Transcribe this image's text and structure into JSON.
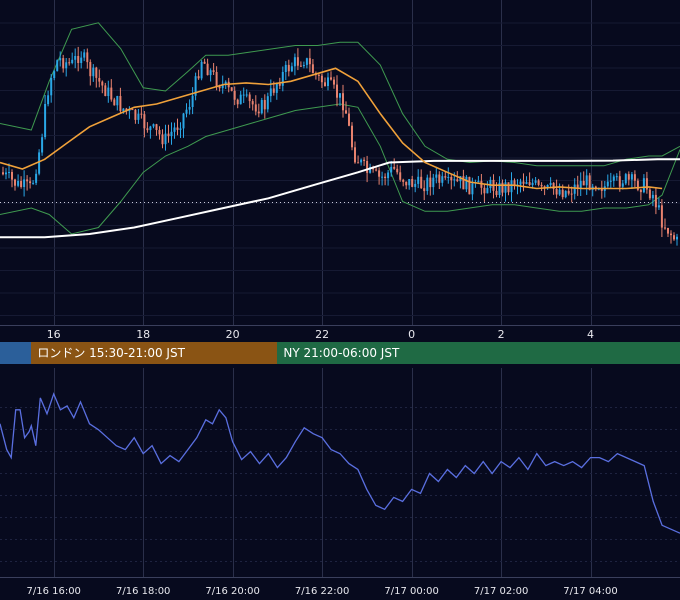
{
  "colors": {
    "background": "#070a1e",
    "grid": "#2a2f4a",
    "candle_up": "#2aa7e6",
    "candle_down": "#e8826e",
    "ma_short": "#f0a13a",
    "ma_long": "#ffffff",
    "bollinger": "#3f9a50",
    "oscillator": "#5a6fe0",
    "session_tokyo": "#2b5f9a",
    "session_london": "#8a5414",
    "session_ny": "#1f6a44"
  },
  "sessions": [
    {
      "label": "",
      "color": "#2b5f9a",
      "start_hour": 14.8,
      "end_hour": 15.5
    },
    {
      "label": "ロンドン 15:30-21:00 JST",
      "color": "#8a5414",
      "start_hour": 15.5,
      "end_hour": 21.0
    },
    {
      "label": "NY 21:00-06:00 JST",
      "color": "#1f6a44",
      "start_hour": 21.0,
      "end_hour": 30.0
    }
  ],
  "chart_data": [
    {
      "type": "candlestick",
      "title": "",
      "x_unit": "hours (JST), 7/16 14:48 – 7/17 05:20",
      "xlim": [
        14.8,
        30.0
      ],
      "ylim": [
        0,
        100
      ],
      "x_tick_labels": [
        "16",
        "18",
        "20",
        "22",
        "0",
        "2",
        "4"
      ],
      "x_tick_hours": [
        16,
        18,
        20,
        22,
        24,
        26,
        28
      ],
      "gridlines": true,
      "reference_line": 62,
      "close_path": [
        [
          14.8,
          53
        ],
        [
          15.2,
          57
        ],
        [
          15.5,
          58
        ],
        [
          15.7,
          45
        ],
        [
          15.9,
          25
        ],
        [
          16.1,
          18
        ],
        [
          16.4,
          20
        ],
        [
          16.6,
          16
        ],
        [
          16.8,
          22
        ],
        [
          17.0,
          25
        ],
        [
          17.3,
          30
        ],
        [
          17.6,
          34
        ],
        [
          17.9,
          37
        ],
        [
          18.2,
          40
        ],
        [
          18.5,
          43
        ],
        [
          18.8,
          38
        ],
        [
          19.1,
          30
        ],
        [
          19.3,
          18
        ],
        [
          19.6,
          24
        ],
        [
          19.9,
          28
        ],
        [
          20.1,
          30
        ],
        [
          20.4,
          32
        ],
        [
          20.7,
          33
        ],
        [
          21.0,
          25
        ],
        [
          21.3,
          20
        ],
        [
          21.6,
          18
        ],
        [
          21.9,
          24
        ],
        [
          22.2,
          27
        ],
        [
          22.5,
          32
        ],
        [
          22.7,
          47
        ],
        [
          23.0,
          53
        ],
        [
          23.3,
          55
        ],
        [
          23.6,
          52
        ],
        [
          23.9,
          56
        ],
        [
          24.2,
          57
        ],
        [
          24.5,
          55
        ],
        [
          24.8,
          57
        ],
        [
          25.1,
          56
        ],
        [
          25.4,
          58
        ],
        [
          25.7,
          57
        ],
        [
          26.0,
          58
        ],
        [
          26.3,
          56
        ],
        [
          26.6,
          55
        ],
        [
          26.9,
          59
        ],
        [
          27.2,
          58
        ],
        [
          27.5,
          59
        ],
        [
          27.8,
          56
        ],
        [
          28.1,
          56
        ],
        [
          28.4,
          58
        ],
        [
          28.7,
          55
        ],
        [
          28.9,
          56
        ],
        [
          29.2,
          57
        ],
        [
          29.4,
          60
        ],
        [
          29.6,
          68
        ],
        [
          30.0,
          76
        ]
      ],
      "series": [
        {
          "name": "",
          "points": [
            [
              14.8,
              50
            ],
            [
              15.3,
              52
            ],
            [
              15.8,
              49
            ],
            [
              16.3,
              44
            ],
            [
              16.8,
              39
            ],
            [
              17.3,
              36
            ],
            [
              17.8,
              33
            ],
            [
              18.3,
              32
            ],
            [
              18.8,
              30
            ],
            [
              19.3,
              28
            ],
            [
              19.8,
              26
            ],
            [
              20.3,
              25.5
            ],
            [
              20.8,
              26
            ],
            [
              21.3,
              25
            ],
            [
              21.8,
              23
            ],
            [
              22.3,
              21
            ],
            [
              22.8,
              25
            ],
            [
              23.3,
              35
            ],
            [
              23.8,
              44
            ],
            [
              24.3,
              50
            ],
            [
              24.8,
              53
            ],
            [
              25.3,
              56
            ],
            [
              25.8,
              57
            ],
            [
              26.3,
              57
            ],
            [
              26.8,
              58
            ],
            [
              27.3,
              57.5
            ],
            [
              27.8,
              58
            ],
            [
              28.3,
              58
            ],
            [
              28.8,
              58
            ],
            [
              29.3,
              57.5
            ],
            [
              29.6,
              58
            ]
          ]
        },
        {
          "name": "",
          "points": [
            [
              14.8,
              73
            ],
            [
              15.8,
              73
            ],
            [
              16.8,
              72
            ],
            [
              17.8,
              70
            ],
            [
              18.8,
              67
            ],
            [
              19.8,
              64
            ],
            [
              20.8,
              61
            ],
            [
              21.8,
              57
            ],
            [
              22.8,
              53
            ],
            [
              23.5,
              50
            ],
            [
              24.5,
              49.5
            ],
            [
              25.5,
              49.5
            ],
            [
              26.5,
              49.5
            ],
            [
              27.5,
              49.5
            ],
            [
              28.5,
              49.4
            ],
            [
              29.5,
              49
            ],
            [
              30.0,
              49
            ]
          ]
        },
        {
          "name": "",
          "points": [
            [
              14.8,
              38
            ],
            [
              15.5,
              40
            ],
            [
              15.9,
              25
            ],
            [
              16.4,
              9
            ],
            [
              17.0,
              7
            ],
            [
              17.5,
              15
            ],
            [
              18.0,
              27
            ],
            [
              18.5,
              28
            ],
            [
              19.0,
              22
            ],
            [
              19.4,
              17
            ],
            [
              19.9,
              17
            ],
            [
              20.4,
              16
            ],
            [
              20.9,
              15
            ],
            [
              21.4,
              14
            ],
            [
              21.9,
              14
            ],
            [
              22.4,
              13
            ],
            [
              22.8,
              13
            ],
            [
              23.3,
              20
            ],
            [
              23.8,
              35
            ],
            [
              24.3,
              45
            ],
            [
              24.8,
              49
            ],
            [
              25.3,
              50
            ],
            [
              25.8,
              49.5
            ],
            [
              26.3,
              50
            ],
            [
              26.8,
              51
            ],
            [
              27.3,
              51
            ],
            [
              27.8,
              51
            ],
            [
              28.3,
              51
            ],
            [
              28.8,
              49
            ],
            [
              29.3,
              48
            ],
            [
              29.6,
              48
            ],
            [
              30.0,
              45
            ]
          ]
        },
        {
          "name": "",
          "points": [
            [
              14.8,
              66
            ],
            [
              15.5,
              64
            ],
            [
              15.9,
              66
            ],
            [
              16.4,
              72
            ],
            [
              17.0,
              70
            ],
            [
              17.5,
              62
            ],
            [
              18.0,
              53
            ],
            [
              18.5,
              48
            ],
            [
              19.0,
              45
            ],
            [
              19.4,
              42
            ],
            [
              19.9,
              40
            ],
            [
              20.4,
              38
            ],
            [
              20.9,
              36
            ],
            [
              21.4,
              34
            ],
            [
              21.9,
              33
            ],
            [
              22.4,
              32
            ],
            [
              22.8,
              33
            ],
            [
              23.3,
              45
            ],
            [
              23.8,
              62
            ],
            [
              24.3,
              65
            ],
            [
              24.8,
              65
            ],
            [
              25.3,
              64
            ],
            [
              25.8,
              63
            ],
            [
              26.3,
              63
            ],
            [
              26.8,
              64
            ],
            [
              27.3,
              65
            ],
            [
              27.8,
              65
            ],
            [
              28.3,
              64
            ],
            [
              28.8,
              64
            ],
            [
              29.3,
              63
            ],
            [
              29.6,
              60
            ],
            [
              30.0,
              46
            ]
          ]
        }
      ]
    },
    {
      "type": "line",
      "title": "",
      "xlim": [
        14.8,
        30.0
      ],
      "ylim": [
        0,
        100
      ],
      "x_tick_labels": [
        "7/16 16:00",
        "7/16 18:00",
        "7/16 20:00",
        "7/16 22:00",
        "7/17 00:00",
        "7/17 02:00",
        "7/17 04:00"
      ],
      "x_tick_hours": [
        16,
        18,
        20,
        22,
        24,
        26,
        28
      ],
      "series": [
        {
          "name": "",
          "values": [
            [
              14.8,
              77
            ],
            [
              14.95,
              64
            ],
            [
              15.05,
              60
            ],
            [
              15.15,
              84
            ],
            [
              15.25,
              84
            ],
            [
              15.35,
              70
            ],
            [
              15.45,
              73
            ],
            [
              15.5,
              76
            ],
            [
              15.6,
              66
            ],
            [
              15.7,
              90
            ],
            [
              15.85,
              82
            ],
            [
              16.0,
              92
            ],
            [
              16.15,
              84
            ],
            [
              16.3,
              86
            ],
            [
              16.45,
              80
            ],
            [
              16.6,
              88
            ],
            [
              16.8,
              77
            ],
            [
              17.0,
              74
            ],
            [
              17.2,
              70
            ],
            [
              17.4,
              66
            ],
            [
              17.6,
              64
            ],
            [
              17.8,
              70
            ],
            [
              18.0,
              62
            ],
            [
              18.2,
              66
            ],
            [
              18.4,
              57
            ],
            [
              18.6,
              61
            ],
            [
              18.8,
              58
            ],
            [
              19.0,
              64
            ],
            [
              19.2,
              70
            ],
            [
              19.4,
              79
            ],
            [
              19.55,
              77
            ],
            [
              19.7,
              84
            ],
            [
              19.85,
              80
            ],
            [
              20.0,
              68
            ],
            [
              20.2,
              59
            ],
            [
              20.4,
              63
            ],
            [
              20.6,
              57
            ],
            [
              20.8,
              62
            ],
            [
              21.0,
              55
            ],
            [
              21.2,
              60
            ],
            [
              21.4,
              68
            ],
            [
              21.6,
              75
            ],
            [
              21.8,
              72
            ],
            [
              22.0,
              70
            ],
            [
              22.2,
              64
            ],
            [
              22.4,
              62
            ],
            [
              22.6,
              57
            ],
            [
              22.8,
              54
            ],
            [
              23.0,
              44
            ],
            [
              23.2,
              36
            ],
            [
              23.4,
              34
            ],
            [
              23.6,
              40
            ],
            [
              23.8,
              38
            ],
            [
              24.0,
              44
            ],
            [
              24.2,
              42
            ],
            [
              24.4,
              52
            ],
            [
              24.6,
              48
            ],
            [
              24.8,
              54
            ],
            [
              25.0,
              50
            ],
            [
              25.2,
              56
            ],
            [
              25.4,
              52
            ],
            [
              25.6,
              58
            ],
            [
              25.8,
              52
            ],
            [
              26.0,
              58
            ],
            [
              26.2,
              55
            ],
            [
              26.4,
              60
            ],
            [
              26.6,
              54
            ],
            [
              26.8,
              62
            ],
            [
              27.0,
              56
            ],
            [
              27.2,
              58
            ],
            [
              27.4,
              56
            ],
            [
              27.6,
              58
            ],
            [
              27.8,
              55
            ],
            [
              28.0,
              60
            ],
            [
              28.2,
              60
            ],
            [
              28.4,
              58
            ],
            [
              28.6,
              62
            ],
            [
              28.8,
              60
            ],
            [
              29.0,
              58
            ],
            [
              29.2,
              56
            ],
            [
              29.4,
              38
            ],
            [
              29.6,
              26
            ],
            [
              30.0,
              22
            ]
          ]
        }
      ]
    }
  ]
}
